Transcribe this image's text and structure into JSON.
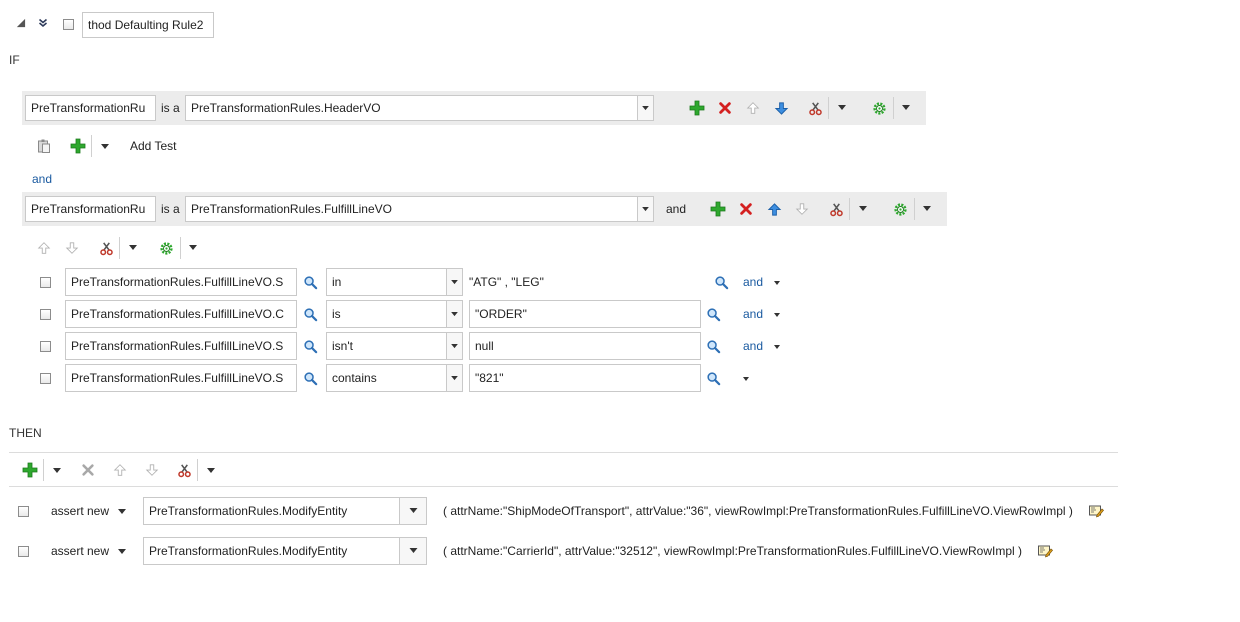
{
  "rule": {
    "name": "thod Defaulting Rule2"
  },
  "if_section": {
    "label": "IF",
    "pattern1": {
      "var_name": "PreTransformationRu",
      "is_a": "is a",
      "fact_type": "PreTransformationRules.HeaderVO"
    },
    "add_test_label": "Add Test",
    "and_connector": "and",
    "pattern2": {
      "var_name": "PreTransformationRu",
      "is_a": "is a",
      "fact_type": "PreTransformationRules.FulfillLineVO",
      "and_label": "and"
    },
    "tests": [
      {
        "left": "PreTransformationRules.FulfillLineVO.S",
        "op": "in",
        "right": "\"ATG\" , \"LEG\"",
        "conj": "and"
      },
      {
        "left": "PreTransformationRules.FulfillLineVO.C",
        "op": "is",
        "right": "\"ORDER\"",
        "conj": "and"
      },
      {
        "left": "PreTransformationRules.FulfillLineVO.S",
        "op": "isn't",
        "right": "null",
        "conj": "and"
      },
      {
        "left": "PreTransformationRules.FulfillLineVO.S",
        "op": "contains",
        "right": "\"821\"",
        "conj": ""
      }
    ]
  },
  "then_section": {
    "label": "THEN",
    "actions": [
      {
        "type": "assert new",
        "target": "PreTransformationRules.ModifyEntity",
        "args": "( attrName:\"ShipModeOfTransport\", attrValue:\"36\", viewRowImpl:PreTransformationRules.FulfillLineVO.ViewRowImpl )"
      },
      {
        "type": "assert new",
        "target": "PreTransformationRules.ModifyEntity",
        "args": "( attrName:\"CarrierId\", attrValue:\"32512\", viewRowImpl:PreTransformationRules.FulfillLineVO.ViewRowImpl )"
      }
    ]
  },
  "colors": {
    "add_green": "#2ea82e",
    "delete_red": "#d42020",
    "link_blue": "#1a5aa0",
    "band_gray": "#ececec"
  }
}
